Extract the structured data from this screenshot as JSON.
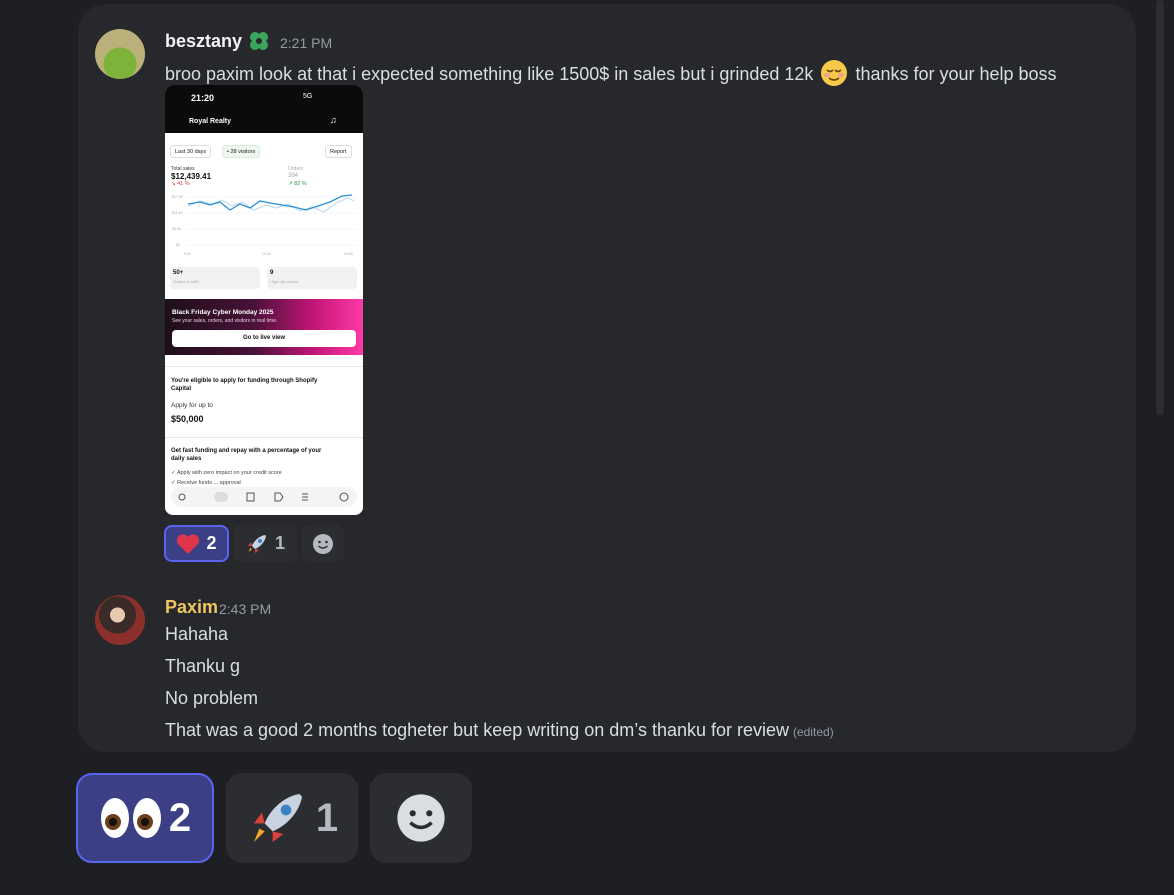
{
  "messages": [
    {
      "username": "besztany",
      "badge_icon": "clover-badge-icon",
      "time": "2:21 PM",
      "text_before": "broo paxim look at that i expected something like 1500$ in sales but i grinded 12k",
      "emoji": "relieved-face-emoji",
      "text_after": "thanks for your help boss",
      "attachment": {
        "status_time": "21:20",
        "status_icons": "5G",
        "store_name": "Royal Realty",
        "filter_period": "Last 30 days",
        "filter_visitors": "• 28 visitors",
        "report_label": "Report",
        "total_sales_label": "Total sales",
        "total_sales_value": "$12,439.41",
        "total_sales_change": "↘ 41 %",
        "orders_label": "Orders",
        "orders_value": "394",
        "orders_change": "↗ 82 %",
        "y_ticks": [
          "$17.5K",
          "$11.4K",
          "$5.8K",
          "$0"
        ],
        "x_ticks": [
          "9:00",
          "10:00",
          "10:00"
        ],
        "card1_value": "50+",
        "card1_label": "Orders to fulfill",
        "card2_value": "9",
        "card2_label": "High risk orders",
        "banner_title": "Black Friday Cyber Monday 2025",
        "banner_subtitle": "See your sales, orders, and visitors in real time.",
        "live_button": "Go to live view",
        "funding_title": "You're eligible to apply for funding through Shopify Capital",
        "apply_label": "Apply for up to",
        "apply_amount": "$50,000",
        "fast_title": "Get fast funding and repay with a percentage of your daily sales",
        "check1": "✓  Apply with zero impact on your credit score",
        "check2": "✓  Receive funds ... approval"
      },
      "reactions": [
        {
          "emoji": "heart-emoji",
          "count": "2",
          "active": true
        },
        {
          "emoji": "rocket-emoji",
          "count": "1",
          "active": false
        },
        {
          "emoji": "add-reaction-icon",
          "count": "",
          "active": false
        }
      ]
    },
    {
      "username": "Paxim",
      "time": "2:43 PM",
      "lines": [
        "Hahaha",
        "Thanku g",
        "No problem",
        "That was a good 2 months  togheter but keep writing on dm’s thanku for review"
      ],
      "edited_label": "(edited)",
      "reactions": [
        {
          "emoji": "eyes-emoji",
          "count": "2",
          "active": true
        },
        {
          "emoji": "rocket-emoji",
          "count": "1",
          "active": false
        },
        {
          "emoji": "add-reaction-icon",
          "count": "",
          "active": false
        }
      ]
    }
  ],
  "colors": {
    "background": "#1e1f22",
    "panel": "#27282c",
    "username1": "#f2f3f5",
    "username2": "#f0c75e",
    "timestamp": "#949ba4",
    "active_reaction_bg": "#3b3f85",
    "active_reaction_border": "#5865f2"
  }
}
